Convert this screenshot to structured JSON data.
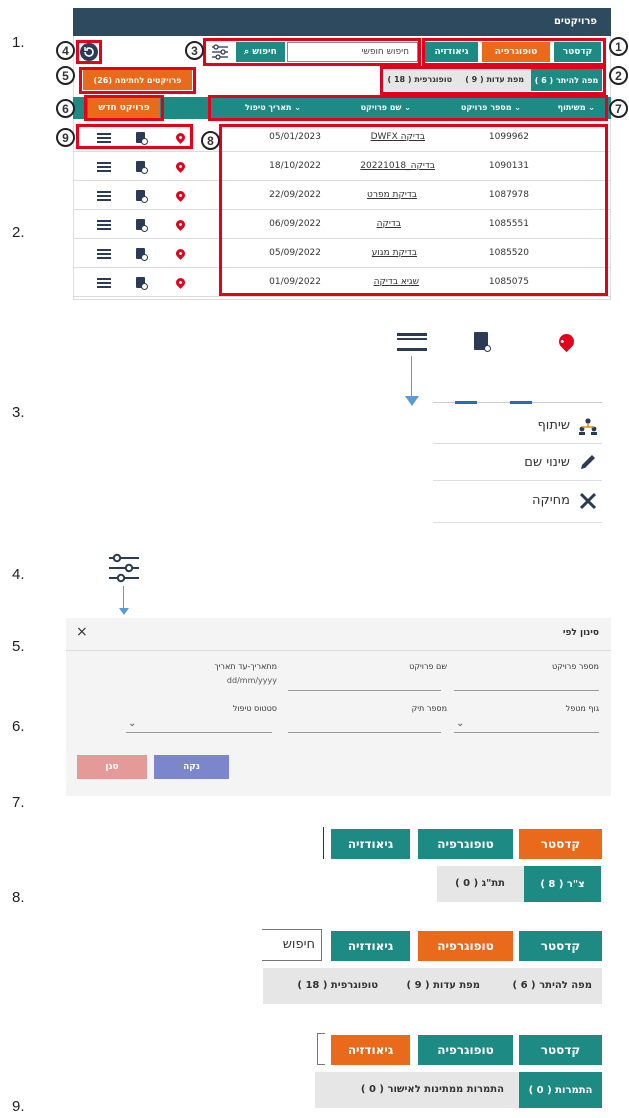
{
  "step_numbers": [
    "1.",
    "2.",
    "3.",
    "4.",
    "5.",
    "6.",
    "7.",
    "8.",
    "9."
  ],
  "callouts": [
    "1",
    "2",
    "3",
    "4",
    "5",
    "6",
    "7",
    "8",
    "9"
  ],
  "header": {
    "title": "פרויקטים"
  },
  "toolbar": {
    "cadastre": "קדסטר",
    "topography": "טופוגרפיה",
    "geodesy": "גיאודזיה",
    "search_placeholder": "חיפוש חופשי",
    "search_button": "חיפוש"
  },
  "subtabs": {
    "map_permit": "מפה להיתר ( 6 )",
    "witness_map": "מפת עדות ( 9 )",
    "topographic": "טופוגרפית ( 18 )"
  },
  "pending_button": "פרויקטים לחתימה (26)",
  "new_project_button": "פרויקט חדש",
  "columns": {
    "share": "משיתוף",
    "project_number": "מספר פרויקט",
    "project_name": "שם פרויקט",
    "handling_date": "תאריך טיפול"
  },
  "rows": [
    {
      "number": "1099962",
      "name": "בדיקה DWFX",
      "date": "05/01/2023"
    },
    {
      "number": "1090131",
      "name": "בדיקה_20221018",
      "date": "18/10/2022"
    },
    {
      "number": "1087978",
      "name": "בדיקת מפרט",
      "date": "22/09/2022"
    },
    {
      "number": "1085551",
      "name": "בדיקה",
      "date": "06/09/2022"
    },
    {
      "number": "1085520",
      "name": "בדיקת מגוע",
      "date": "05/09/2022"
    },
    {
      "number": "1085075",
      "name": "שגיא בדיקה",
      "date": "01/09/2022"
    }
  ],
  "menu": {
    "share": "שיתוף",
    "rename": "שינוי שם",
    "delete": "מחיקה"
  },
  "filter": {
    "title": "סינון לפי",
    "close": "×",
    "project_number": "מספר פרויקט",
    "project_name": "שם פרויקט",
    "date_range": "מתאריך-עד תאריך",
    "date_placeholder": "dd/mm/yyyy",
    "handling_body": "גוף מטפל",
    "file_number": "מספר תיק",
    "handling_status": "סטטוס טיפול",
    "clear": "נקה",
    "apply": "סנן"
  },
  "examples": {
    "ex1_tabs": [
      "צ\"ר ( 8 )",
      "תת\"ג ( 0 )"
    ],
    "ex2_search": "חיפוש",
    "ex2_tabs": [
      "מפה להיתר ( 6 )",
      "מפת עדות ( 9 )",
      "טופוגרפית ( 18 )"
    ],
    "ex3_tabs": [
      "התמרות ( 0 )",
      "התמרות ממתינות לאישור ( 0 )"
    ]
  },
  "colors": {
    "teal": "#1e8a84",
    "orange": "#ea6a1c",
    "navy": "#2b3a55",
    "red": "#e2001a",
    "header": "#2e4a5e"
  }
}
